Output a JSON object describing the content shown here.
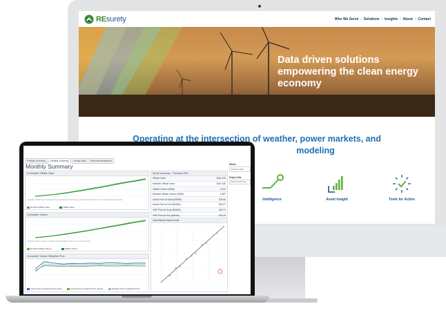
{
  "site": {
    "logo_brand": "RE",
    "logo_rest": "surety",
    "nav": [
      "Who We Serve",
      "Solutions",
      "Insights",
      "About",
      "Contact"
    ],
    "hero_title": "Data driven solutions empowering the clean energy economy",
    "tagline_line1": "Operating at the intersection of weather, power markets, and",
    "tagline_line2": "modeling",
    "features": [
      "Intelligence",
      "Asset Insight",
      "Tools for Action"
    ]
  },
  "dashboard": {
    "tabs": [
      "Portfolio Summary",
      "Monthly Summary",
      "Hourly Data",
      "Revenue Breakdown"
    ],
    "title": "Monthly Summary",
    "panels": {
      "cumulative_value": {
        "title": "Cumulative Offtake Value",
        "legend": [
          "Modeled Offtake Value",
          "Offtake Value"
        ],
        "note": "Cumulative Offtake Value is calculated using modeled and actual hourly generation and market prices for the selected project and period."
      },
      "cumulative_volume": {
        "title": "Cumulative Volume",
        "legend": [
          "Modeled Offtake Volume",
          "Offtake Volume"
        ],
        "note": "Cumulative Volume compares modeled and actual offtake volume over the selected period."
      },
      "weighted_price": {
        "title": "Cumulative Volume Weighted Price",
        "legend": [
          "Actual Volume Weighted Price (Hub)",
          "Actual Volume Weighted Price (Node)",
          "Modeled Volume Weighted Price"
        ]
      },
      "audit": {
        "title": "Operational Impact Audit",
        "xlabel": "Modeled Offtake Value",
        "ylabel": "Offtake Value"
      }
    },
    "monthly_summary": {
      "title": "Month Summary - February 2020",
      "rows": [
        [
          "Offtake Value",
          "$161,229"
        ],
        [
          "Modeled Offtake Value",
          "$164,155"
        ],
        [
          "Offtake Volume (MWh)",
          "6,324"
        ],
        [
          "Modeled Offtake Volume (MWh)",
          "6,387"
        ],
        [
          "Actual Price At Node ($/MWh)",
          "$25.50"
        ],
        [
          "Actual Price At Hub ($/MWh)",
          "$24.07"
        ],
        [
          "VWP Price At Node ($/MWh)",
          "$25.71"
        ],
        [
          "VWP Price At Hub ($/MWh)",
          "$26.26"
        ]
      ]
    },
    "filters": {
      "month_label": "Month",
      "month_value": "February 2020",
      "project_label": "Project Site",
      "project_value": "Select project site"
    }
  },
  "chart_data": [
    {
      "type": "line",
      "title": "Cumulative Offtake Value",
      "series": [
        {
          "name": "Modeled Offtake Value",
          "values": [
            0,
            4,
            9,
            15,
            22,
            30,
            38,
            46,
            55,
            64,
            72,
            80,
            88
          ]
        },
        {
          "name": "Offtake Value",
          "values": [
            0,
            3,
            8,
            13,
            20,
            27,
            35,
            43,
            51,
            60,
            69,
            76,
            84
          ]
        }
      ]
    },
    {
      "type": "line",
      "title": "Cumulative Volume",
      "series": [
        {
          "name": "Modeled Offtake Volume",
          "values": [
            0,
            5,
            10,
            17,
            24,
            31,
            39,
            47,
            56,
            64,
            73,
            81,
            89
          ]
        },
        {
          "name": "Offtake Volume",
          "values": [
            0,
            4,
            9,
            15,
            22,
            29,
            37,
            45,
            53,
            61,
            70,
            78,
            85
          ]
        }
      ]
    },
    {
      "type": "line",
      "title": "Cumulative Volume Weighted Price",
      "series": [
        {
          "name": "Actual Volume Weighted Price (Hub)",
          "values": [
            40,
            62,
            58,
            55,
            57,
            56,
            58,
            57,
            59,
            58,
            57,
            58,
            58
          ]
        },
        {
          "name": "Actual Volume Weighted Price (Node)",
          "values": [
            35,
            50,
            49,
            48,
            49,
            48,
            49,
            50,
            49,
            49,
            50,
            49,
            49
          ]
        },
        {
          "name": "Modeled Volume Weighted Price",
          "values": [
            30,
            55,
            53,
            52,
            53,
            52,
            53,
            54,
            53,
            54,
            53,
            54,
            54
          ]
        }
      ]
    },
    {
      "type": "scatter",
      "title": "Operational Impact Audit",
      "xlabel": "Modeled Offtake Value",
      "ylabel": "Offtake Value",
      "points": [
        [
          12,
          10
        ],
        [
          20,
          22
        ],
        [
          26,
          24
        ],
        [
          34,
          36
        ],
        [
          41,
          40
        ],
        [
          47,
          44
        ],
        [
          55,
          57
        ],
        [
          61,
          59
        ],
        [
          75,
          74
        ]
      ]
    }
  ]
}
